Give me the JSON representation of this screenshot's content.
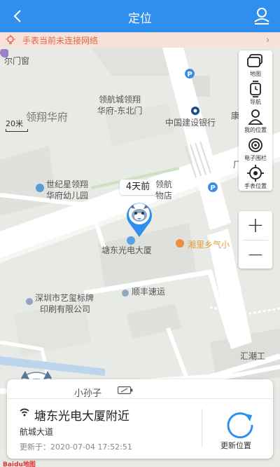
{
  "header": {
    "title": "定位"
  },
  "alert": {
    "text": "手表当前未连接网络"
  },
  "map": {
    "scale": "20米",
    "labels": {
      "top_left": "尔门窗",
      "lh_north": "领航城领翔",
      "lh_north2": "华府-东北门",
      "lxhf": "领翔华府",
      "bank": "中国建设银行",
      "kindergarten1": "世纪星领翔",
      "kindergarten2": "华府幼儿园",
      "hotel1": "领航",
      "hotel2": "物店",
      "building": "塘东光电大厦",
      "restaurant": "湘里乡气小",
      "company1": "深圳市艺玺标牌",
      "company2": "印刷有限公司",
      "express": "顺丰速运",
      "huichao": "汇潮工",
      "side1": "康",
      "side2": "厂"
    },
    "baidu": "Baidu地图"
  },
  "toolbar": {
    "items": [
      {
        "label": "地图",
        "icon": "map-layers-icon"
      },
      {
        "label": "导航",
        "icon": "watch-icon"
      },
      {
        "label": "我的位置",
        "icon": "person-icon"
      },
      {
        "label": "电子围栏",
        "icon": "fence-icon"
      },
      {
        "label": "手表位置",
        "icon": "target-icon"
      }
    ]
  },
  "zoom": {
    "in": "+",
    "out": "−"
  },
  "marker": {
    "bubble": "4天前"
  },
  "card": {
    "name": "小孙子",
    "address": "塘东光电大厦附近",
    "street": "航城大道",
    "updated": "更新于：2020-07-04 17:52:51",
    "refresh_label": "更新位置"
  },
  "colors": {
    "primary": "#2f8fef",
    "alert_text": "#e0664a",
    "alert_bg": "#f6e2d8"
  }
}
